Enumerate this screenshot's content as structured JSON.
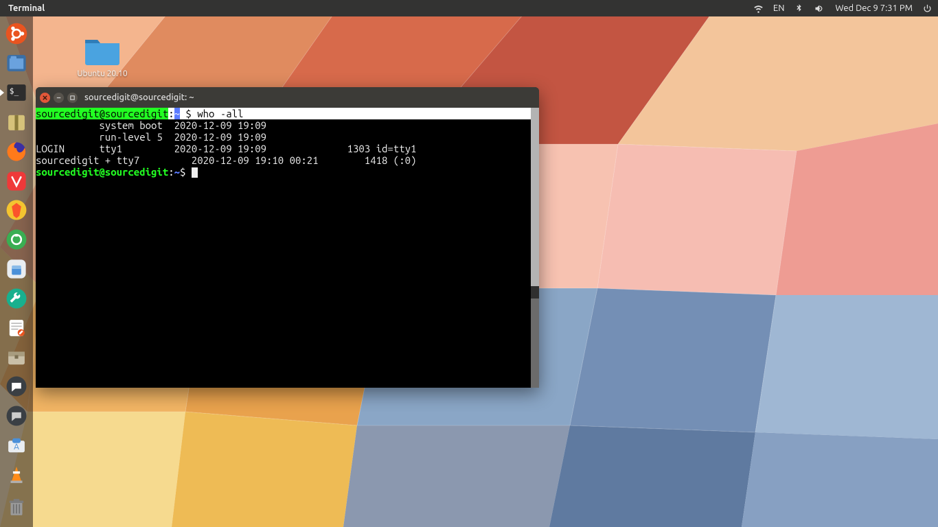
{
  "top_panel": {
    "app_name": "Terminal",
    "lang": "EN",
    "datetime": "Wed Dec  9  7:31 PM"
  },
  "desktop": {
    "folder_label": "Ubuntu 20.10"
  },
  "launcher_icons": [
    "ubuntu-dash",
    "files",
    "terminal",
    "archive",
    "firefox",
    "vivaldi",
    "brave",
    "screenshot",
    "software-updater",
    "settings-wrench",
    "gedit",
    "archive-manager",
    "chat-app",
    "chat-app2",
    "software-store",
    "vlc"
  ],
  "terminal": {
    "window_title": "sourcedigit@sourcedigit: ~",
    "prompt_user": "sourcedigit@sourcedigit",
    "prompt_path": "~",
    "prompt_symbol": "$",
    "command": "who -all",
    "output": [
      "           system boot  2020-12-09 19:09",
      "           run-level 5  2020-12-09 19:09",
      "LOGIN      tty1         2020-12-09 19:09              1303 id=tty1",
      "sourcedigit + tty7         2020-12-09 19:10 00:21        1418 (:0)"
    ]
  }
}
